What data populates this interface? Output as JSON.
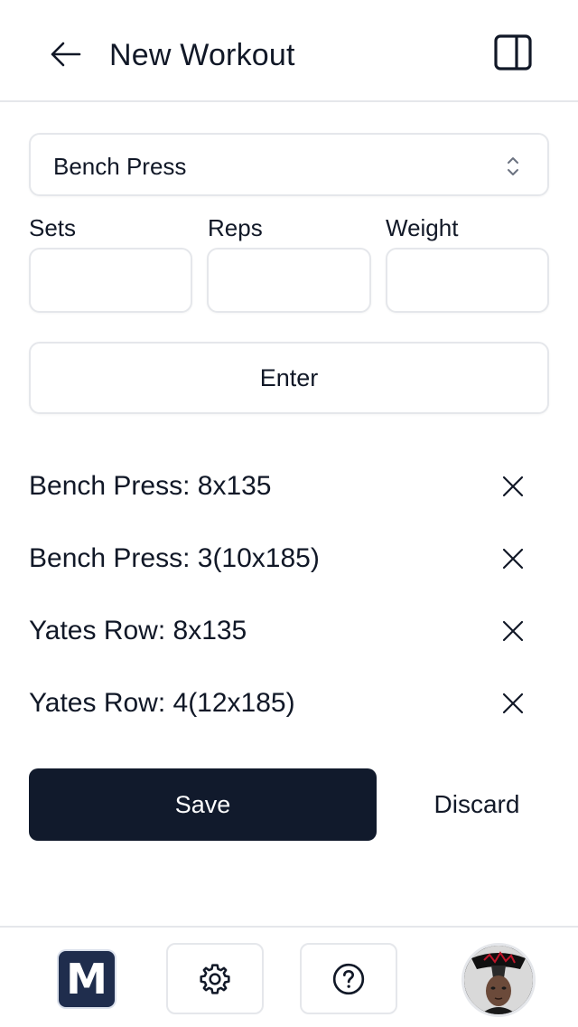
{
  "header": {
    "title": "New Workout",
    "back_icon": "arrow-left-icon",
    "panel_icon": "sidebar-panel-icon"
  },
  "exercise_select": {
    "value": "Bench Press",
    "icon": "chevron-up-down-icon"
  },
  "fields": {
    "sets_label": "Sets",
    "reps_label": "Reps",
    "weight_label": "Weight",
    "sets_value": "",
    "reps_value": "",
    "weight_value": ""
  },
  "enter_label": "Enter",
  "entries": [
    {
      "text": "Bench Press: 8x135"
    },
    {
      "text": "Bench Press: 3(10x185)"
    },
    {
      "text": "Yates Row: 8x135"
    },
    {
      "text": "Yates Row: 4(12x185)"
    }
  ],
  "actions": {
    "save_label": "Save",
    "discard_label": "Discard"
  },
  "footer": {
    "logo_letter": "M",
    "settings_icon": "gear-icon",
    "help_icon": "help-circle-icon",
    "avatar": "user-avatar"
  },
  "colors": {
    "primary_dark": "#111a2c",
    "logo_bg": "#1f2d4d",
    "border": "#e5e7eb",
    "text": "#111827"
  }
}
